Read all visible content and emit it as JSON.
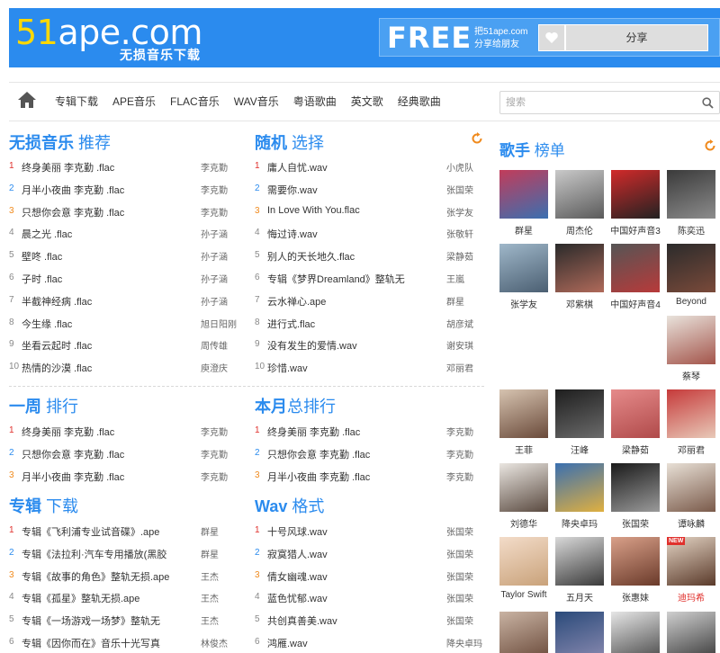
{
  "header": {
    "logo_number": "51",
    "logo_rest": "ape.com",
    "logo_tagline": "无损音乐下载",
    "free_label": "FREE",
    "share_line1": "把51ape.com",
    "share_line2": "分享给朋友",
    "share_button": "分享",
    "heart_icon": "heart-icon",
    "colors": {
      "header_bg": "#2b8bee",
      "logo_accent": "#ffd800",
      "rank1": "#e0302c",
      "rank2": "#2b8bee",
      "rank3": "#f08a1d"
    }
  },
  "nav": {
    "items": [
      "专辑下载",
      "APE音乐",
      "FLAC音乐",
      "WAV音乐",
      "粤语歌曲",
      "英文歌",
      "经典歌曲"
    ],
    "search_placeholder": "搜索"
  },
  "sections": {
    "lossless": {
      "title_a": "无损音乐",
      "title_b": " 推荐",
      "rows": [
        {
          "n": "1",
          "name": "终身美丽 李克勤 .flac",
          "artist": "李克勤"
        },
        {
          "n": "2",
          "name": "月半小夜曲 李克勤 .flac",
          "artist": "李克勤"
        },
        {
          "n": "3",
          "name": "只想你会意 李克勤 .flac",
          "artist": "李克勤"
        },
        {
          "n": "4",
          "name": "晨之光 .flac",
          "artist": "孙子涵"
        },
        {
          "n": "5",
          "name": "壁咚 .flac",
          "artist": "孙子涵"
        },
        {
          "n": "6",
          "name": "子时 .flac",
          "artist": "孙子涵"
        },
        {
          "n": "7",
          "name": "半截神经病 .flac",
          "artist": "孙子涵"
        },
        {
          "n": "8",
          "name": "今生缘 .flac",
          "artist": "旭日阳刚"
        },
        {
          "n": "9",
          "name": "坐看云起时 .flac",
          "artist": "周传雄"
        },
        {
          "n": "10",
          "name": "热情的沙漠 .flac",
          "artist": "庾澄庆"
        }
      ]
    },
    "random": {
      "title_a": "随机",
      "title_b": " 选择",
      "rows": [
        {
          "n": "1",
          "name": "庸人自忧.wav",
          "artist": "小虎队"
        },
        {
          "n": "2",
          "name": "需要你.wav",
          "artist": "张国荣"
        },
        {
          "n": "3",
          "name": "In Love With You.flac",
          "artist": "张学友"
        },
        {
          "n": "4",
          "name": "悔过诗.wav",
          "artist": "张敬轩"
        },
        {
          "n": "5",
          "name": "别人的天长地久.flac",
          "artist": "梁静茹"
        },
        {
          "n": "6",
          "name": "专辑《梦界Dreamland》整轨无",
          "artist": "王嵐"
        },
        {
          "n": "7",
          "name": "云水禅心.ape",
          "artist": "群星"
        },
        {
          "n": "8",
          "name": "进行式.flac",
          "artist": "胡彦斌"
        },
        {
          "n": "9",
          "name": "没有发生的爱情.wav",
          "artist": "谢安琪"
        },
        {
          "n": "10",
          "name": "珍惜.wav",
          "artist": "邓丽君"
        }
      ]
    },
    "week": {
      "title_a": "一周",
      "title_b": " 排行",
      "rows": [
        {
          "n": "1",
          "name": "终身美丽 李克勤 .flac",
          "artist": "李克勤"
        },
        {
          "n": "2",
          "name": "只想你会意 李克勤 .flac",
          "artist": "李克勤"
        },
        {
          "n": "3",
          "name": "月半小夜曲 李克勤 .flac",
          "artist": "李克勤"
        }
      ]
    },
    "month": {
      "title_a": "本月",
      "title_b": "总排行",
      "rows": [
        {
          "n": "1",
          "name": "终身美丽 李克勤 .flac",
          "artist": "李克勤"
        },
        {
          "n": "2",
          "name": "只想你会意 李克勤 .flac",
          "artist": "李克勤"
        },
        {
          "n": "3",
          "name": "月半小夜曲 李克勤 .flac",
          "artist": "李克勤"
        }
      ]
    },
    "albums": {
      "title_a": "专辑",
      "title_b": " 下载",
      "rows": [
        {
          "n": "1",
          "name": "专辑《飞利浦专业试音碟》.ape",
          "artist": "群星"
        },
        {
          "n": "2",
          "name": "专辑《法拉利·汽车专用播放(黑胶",
          "artist": "群星"
        },
        {
          "n": "3",
          "name": "专辑《故事的角色》整轨无损.ape",
          "artist": "王杰"
        },
        {
          "n": "4",
          "name": "专辑《孤星》整轨无损.ape",
          "artist": "王杰"
        },
        {
          "n": "5",
          "name": "专辑《一场游戏一场梦》整轨无",
          "artist": "王杰"
        },
        {
          "n": "6",
          "name": "专辑《因你而在》音乐十光写真",
          "artist": "林俊杰"
        }
      ]
    },
    "wav": {
      "title_a": "Wav",
      "title_b": " 格式",
      "rows": [
        {
          "n": "1",
          "name": "十号风球.wav",
          "artist": "张国荣"
        },
        {
          "n": "2",
          "name": "寂寞猎人.wav",
          "artist": "张国荣"
        },
        {
          "n": "3",
          "name": "倩女幽魂.wav",
          "artist": "张国荣"
        },
        {
          "n": "4",
          "name": "蓝色忧郁.wav",
          "artist": "张国荣"
        },
        {
          "n": "5",
          "name": "共创真善美.wav",
          "artist": "张国荣"
        },
        {
          "n": "6",
          "name": "鸿雁.wav",
          "artist": "降央卓玛"
        }
      ]
    }
  },
  "singers": {
    "title_a": "歌手",
    "title_b": " 榜单",
    "new_badge": "NEW",
    "items": [
      {
        "name": "群星",
        "c1": "#c23c5a",
        "c2": "#3a6fb0"
      },
      {
        "name": "周杰伦",
        "c1": "#c9c9c9",
        "c2": "#5a5a5a"
      },
      {
        "name": "中国好声音3",
        "c1": "#d22a2a",
        "c2": "#222222"
      },
      {
        "name": "陈奕迅",
        "c1": "#3a3a3a",
        "c2": "#8c8c8c"
      },
      {
        "name": "张学友",
        "c1": "#9fb7c9",
        "c2": "#4b5f72"
      },
      {
        "name": "邓紫棋",
        "c1": "#2a2a2a",
        "c2": "#b06a5a"
      },
      {
        "name": "中国好声音4",
        "c1": "#555555",
        "c2": "#b83a3a"
      },
      {
        "name": "Beyond",
        "c1": "#2b2b2b",
        "c2": "#7a4a3a"
      },
      {
        "name": "蔡琴",
        "c1": "#e9e3dc",
        "c2": "#a3544a"
      },
      {
        "name": "王菲",
        "c1": "#d6c3b0",
        "c2": "#6a4a3a"
      },
      {
        "name": "汪峰",
        "c1": "#1e1e1e",
        "c2": "#6b6b6b"
      },
      {
        "name": "梁静茹",
        "c1": "#e58a8a",
        "c2": "#b04a4a"
      },
      {
        "name": "邓丽君",
        "c1": "#c63a3a",
        "c2": "#e8c9b8"
      },
      {
        "name": "刘德华",
        "c1": "#eae6e1",
        "c2": "#5a4a40"
      },
      {
        "name": "降央卓玛",
        "c1": "#3a6fb0",
        "c2": "#e0b040"
      },
      {
        "name": "张国荣",
        "c1": "#1a1a1a",
        "c2": "#9a9a9a"
      },
      {
        "name": "谭咏麟",
        "c1": "#e8e0d6",
        "c2": "#7a5a4a"
      },
      {
        "name": "Taylor Swift",
        "c1": "#f3dcc9",
        "c2": "#c9a27a"
      },
      {
        "name": "五月天",
        "c1": "#d9d9d9",
        "c2": "#3a3a3a"
      },
      {
        "name": "张惠妹",
        "c1": "#d9a089",
        "c2": "#6a3a2a"
      },
      {
        "name": "迪玛希",
        "c1": "#e3d3c3",
        "c2": "#5a3a2a"
      },
      {
        "name": "",
        "c1": "#c9b3a3",
        "c2": "#6a4a3a"
      },
      {
        "name": "",
        "c1": "#2a4a7a",
        "c2": "#8a8ab0"
      },
      {
        "name": "",
        "c1": "#e6e6e6",
        "c2": "#4a4a4a"
      },
      {
        "name": "",
        "c1": "#cfcfcf",
        "c2": "#3a3a3a"
      }
    ]
  }
}
